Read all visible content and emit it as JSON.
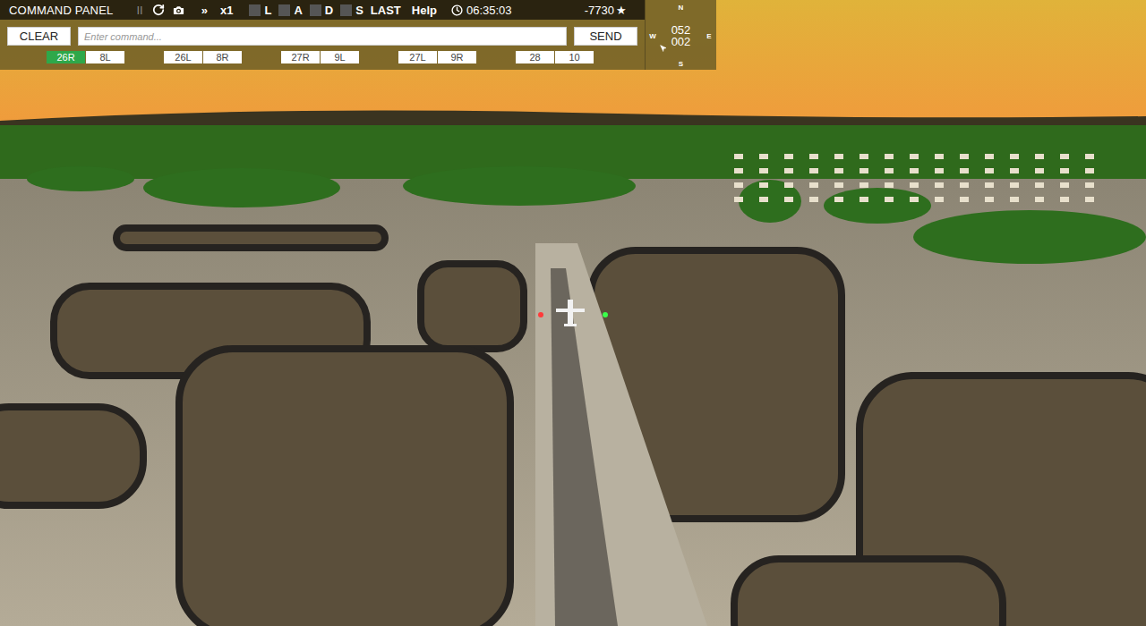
{
  "panel": {
    "title": "COMMAND PANEL",
    "pause": "II",
    "fast_forward": "»",
    "speed": "x1",
    "toggles": [
      {
        "label": "L",
        "checked": false
      },
      {
        "label": "A",
        "checked": false
      },
      {
        "label": "D",
        "checked": false
      },
      {
        "label": "S",
        "checked": false
      }
    ],
    "last": "LAST",
    "help": "Help",
    "time": "06:35:03",
    "score": "-7730",
    "star": "★"
  },
  "command": {
    "clear": "CLEAR",
    "placeholder": "Enter command...",
    "send": "SEND"
  },
  "runways": [
    [
      {
        "label": "26R",
        "selected": true
      },
      {
        "label": "8L",
        "selected": false
      }
    ],
    [
      {
        "label": "26L",
        "selected": false
      },
      {
        "label": "8R",
        "selected": false
      }
    ],
    [
      {
        "label": "27R",
        "selected": false
      },
      {
        "label": "9L",
        "selected": false
      }
    ],
    [
      {
        "label": "27L",
        "selected": false
      },
      {
        "label": "9R",
        "selected": false
      }
    ],
    [
      {
        "label": "28",
        "selected": false
      },
      {
        "label": "10",
        "selected": false
      }
    ]
  ],
  "compass": {
    "north": "N",
    "west": "W",
    "east": "E",
    "south": "S",
    "wind_direction": "052",
    "wind_speed": "002"
  }
}
